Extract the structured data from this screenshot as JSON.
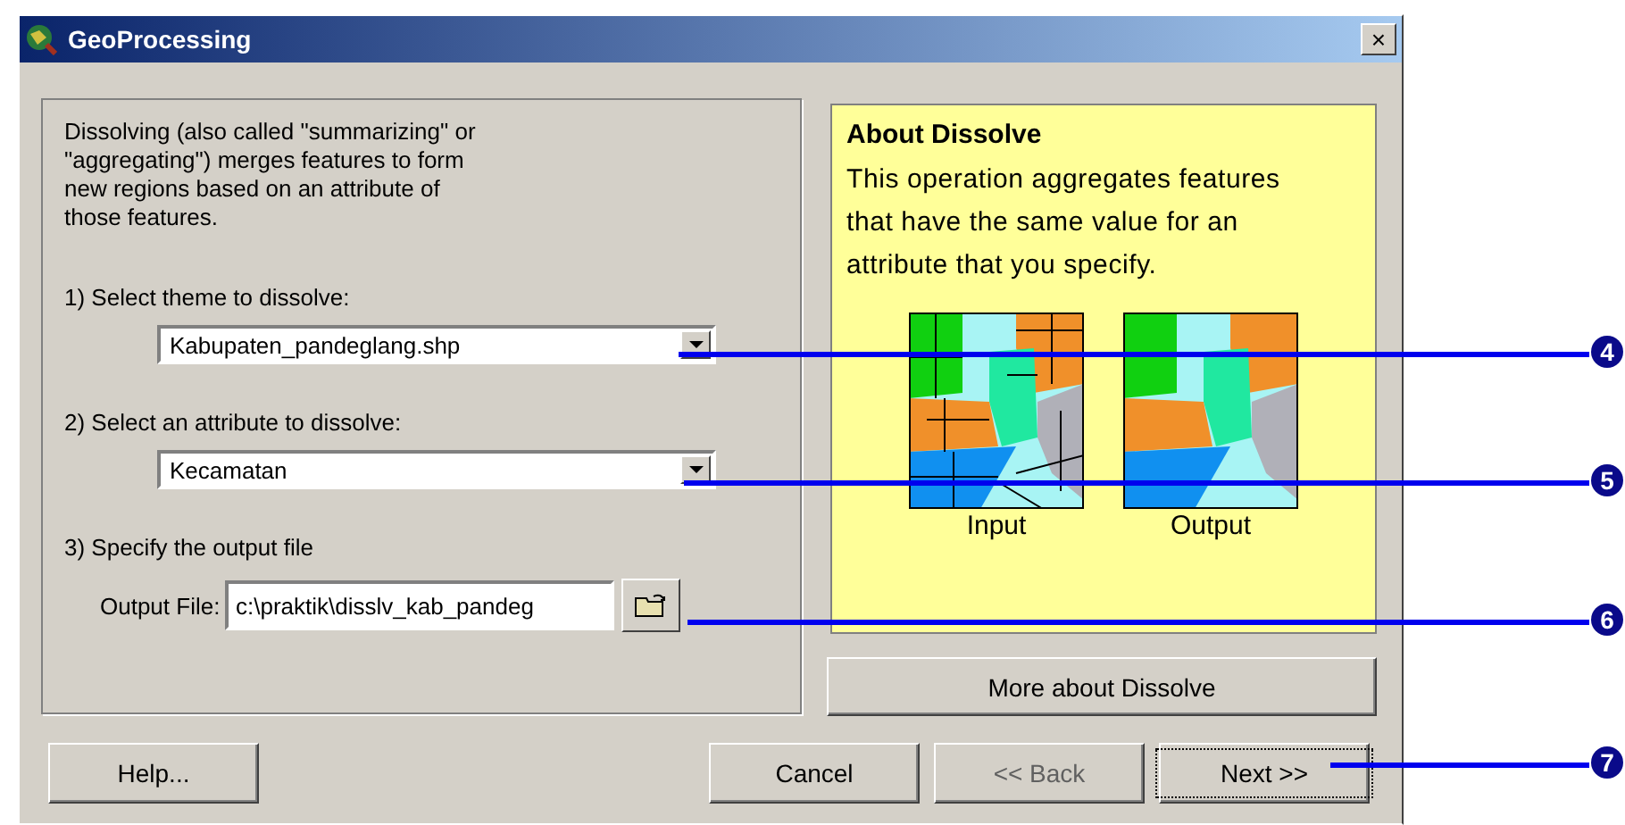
{
  "window": {
    "title": "GeoProcessing",
    "close": "×"
  },
  "intro": "Dissolving (also called \"summarizing\" or \"aggregating\") merges features to form new regions based on an attribute of those features.",
  "steps": [
    {
      "kind": "dropdown",
      "label": "1) Select theme to dissolve:",
      "value": "Kabupaten_pandeglang.shp"
    },
    {
      "kind": "dropdown",
      "label": "2) Select an attribute to dissolve:",
      "value": "Kecamatan"
    },
    {
      "kind": "file",
      "label": "3) Specify the output file",
      "field_label": "Output File:",
      "value": "c:\\praktik\\disslv_kab_pandeg"
    }
  ],
  "about": {
    "title": "About Dissolve",
    "text": "This operation aggregates features that have the same value for an attribute that you specify.",
    "maps": [
      {
        "caption": "Input"
      },
      {
        "caption": "Output"
      }
    ],
    "button": "More about Dissolve"
  },
  "buttons": [
    {
      "label": "Help...",
      "disabled": false,
      "focused": false
    },
    {
      "label": "Cancel",
      "disabled": false,
      "focused": false
    },
    {
      "label": "<< Back",
      "disabled": true,
      "focused": false
    },
    {
      "label": "Next >>",
      "disabled": false,
      "focused": true
    }
  ],
  "callouts": [
    "4",
    "5",
    "6",
    "7"
  ]
}
